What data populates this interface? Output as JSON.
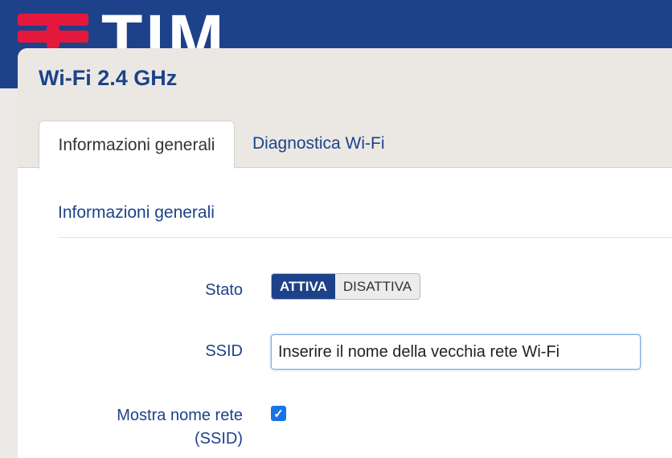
{
  "brand": {
    "logo_text": "TIM",
    "colors": {
      "header_blue": "#1d428a",
      "logo_red": "#e4183c",
      "accent_blue": "#1a73e8"
    }
  },
  "panel": {
    "title": "Wi-Fi 2.4 GHz",
    "tabs": [
      {
        "label": "Informazioni generali",
        "active": true
      },
      {
        "label": "Diagnostica Wi-Fi",
        "active": false
      }
    ]
  },
  "section": {
    "title": "Informazioni generali"
  },
  "form": {
    "stato": {
      "label": "Stato",
      "options": [
        "ATTIVA",
        "DISATTIVA"
      ],
      "selected": "ATTIVA"
    },
    "ssid": {
      "label": "SSID",
      "value": "Inserire il nome della vecchia rete Wi-Fi"
    },
    "mostra_nome_rete": {
      "label_line1": "Mostra nome rete",
      "label_line2": "(SSID)",
      "checked": true,
      "check_icon": "checkmark-icon"
    }
  }
}
